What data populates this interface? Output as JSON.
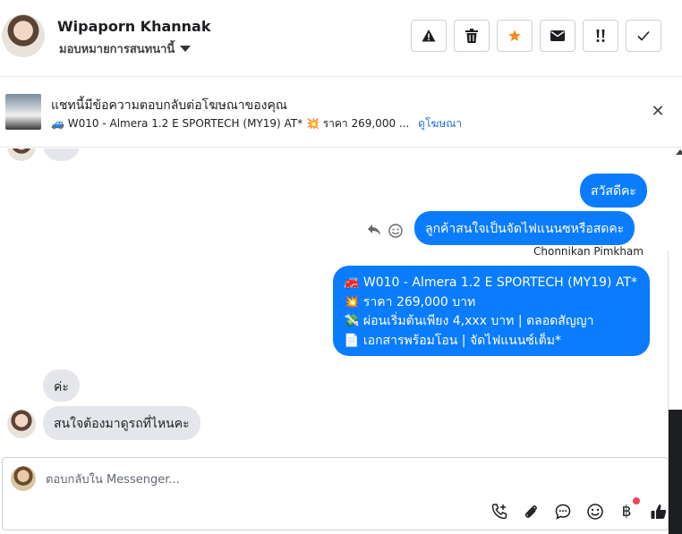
{
  "header": {
    "contact_name": "Wipaporn Khannak",
    "assign_label": "มอบหมายการสนทนานี้",
    "buttons": [
      {
        "name": "report-spam-button",
        "icon": "warning-icon",
        "glyph": "⚠"
      },
      {
        "name": "delete-button",
        "icon": "trash-icon",
        "glyph": "🗑"
      },
      {
        "name": "star-button",
        "icon": "star-icon",
        "glyph": "★"
      },
      {
        "name": "mark-unread-button",
        "icon": "envelope-icon",
        "glyph": "✉"
      },
      {
        "name": "follow-up-button",
        "icon": "exclamation-icon",
        "glyph": "!!"
      },
      {
        "name": "mark-done-button",
        "icon": "check-icon",
        "glyph": "✓"
      }
    ]
  },
  "ad_banner": {
    "title": "แชทนี้มีข้อความตอบกลับต่อโฆษณาของคุณ",
    "subtitle": "🚙 W010 - Almera 1.2 E SPORTECH (MY19) AT* 💥 ราคา 269,000 ...",
    "link": "ดูโฆษณา",
    "close_glyph": "✕"
  },
  "messages": {
    "partial_top": "ค่ะ",
    "out_greeting": "สวัสดีคะ",
    "out_question": "ลูกค้าสนใจเป็นจัดไฟแนนซหรือสดคะ",
    "sender_name": "Chonnikan Pimkham",
    "ad_lines": [
      "🚒 W010 - Almera 1.2 E SPORTECH (MY19) AT*",
      "💥 ราคา 269,000 บาท",
      "💸 ผ่อนเริ่มต้นเพียง 4,xxx บาท | ตลอดสัญญา",
      "📄 เอกสารพร้อมโอน | จัดไฟแนนซ์เต็ม*"
    ],
    "in_reply_1": "ค่ะ",
    "in_reply_2": "สนใจต้องมาดูรถที่ไหนคะ"
  },
  "composer": {
    "placeholder": "ตอบกลับใน Messenger...",
    "tools": [
      "phone-plus-icon",
      "paperclip-icon",
      "chat-bubble-icon",
      "emoji-icon",
      "baht-icon",
      "thumbs-up-icon"
    ]
  },
  "colors": {
    "accent": "#0a7cff",
    "incoming_bubble": "#e4e6eb",
    "link": "#216fdb",
    "notification_dot": "#f3425f",
    "star": "#f28c1b"
  }
}
